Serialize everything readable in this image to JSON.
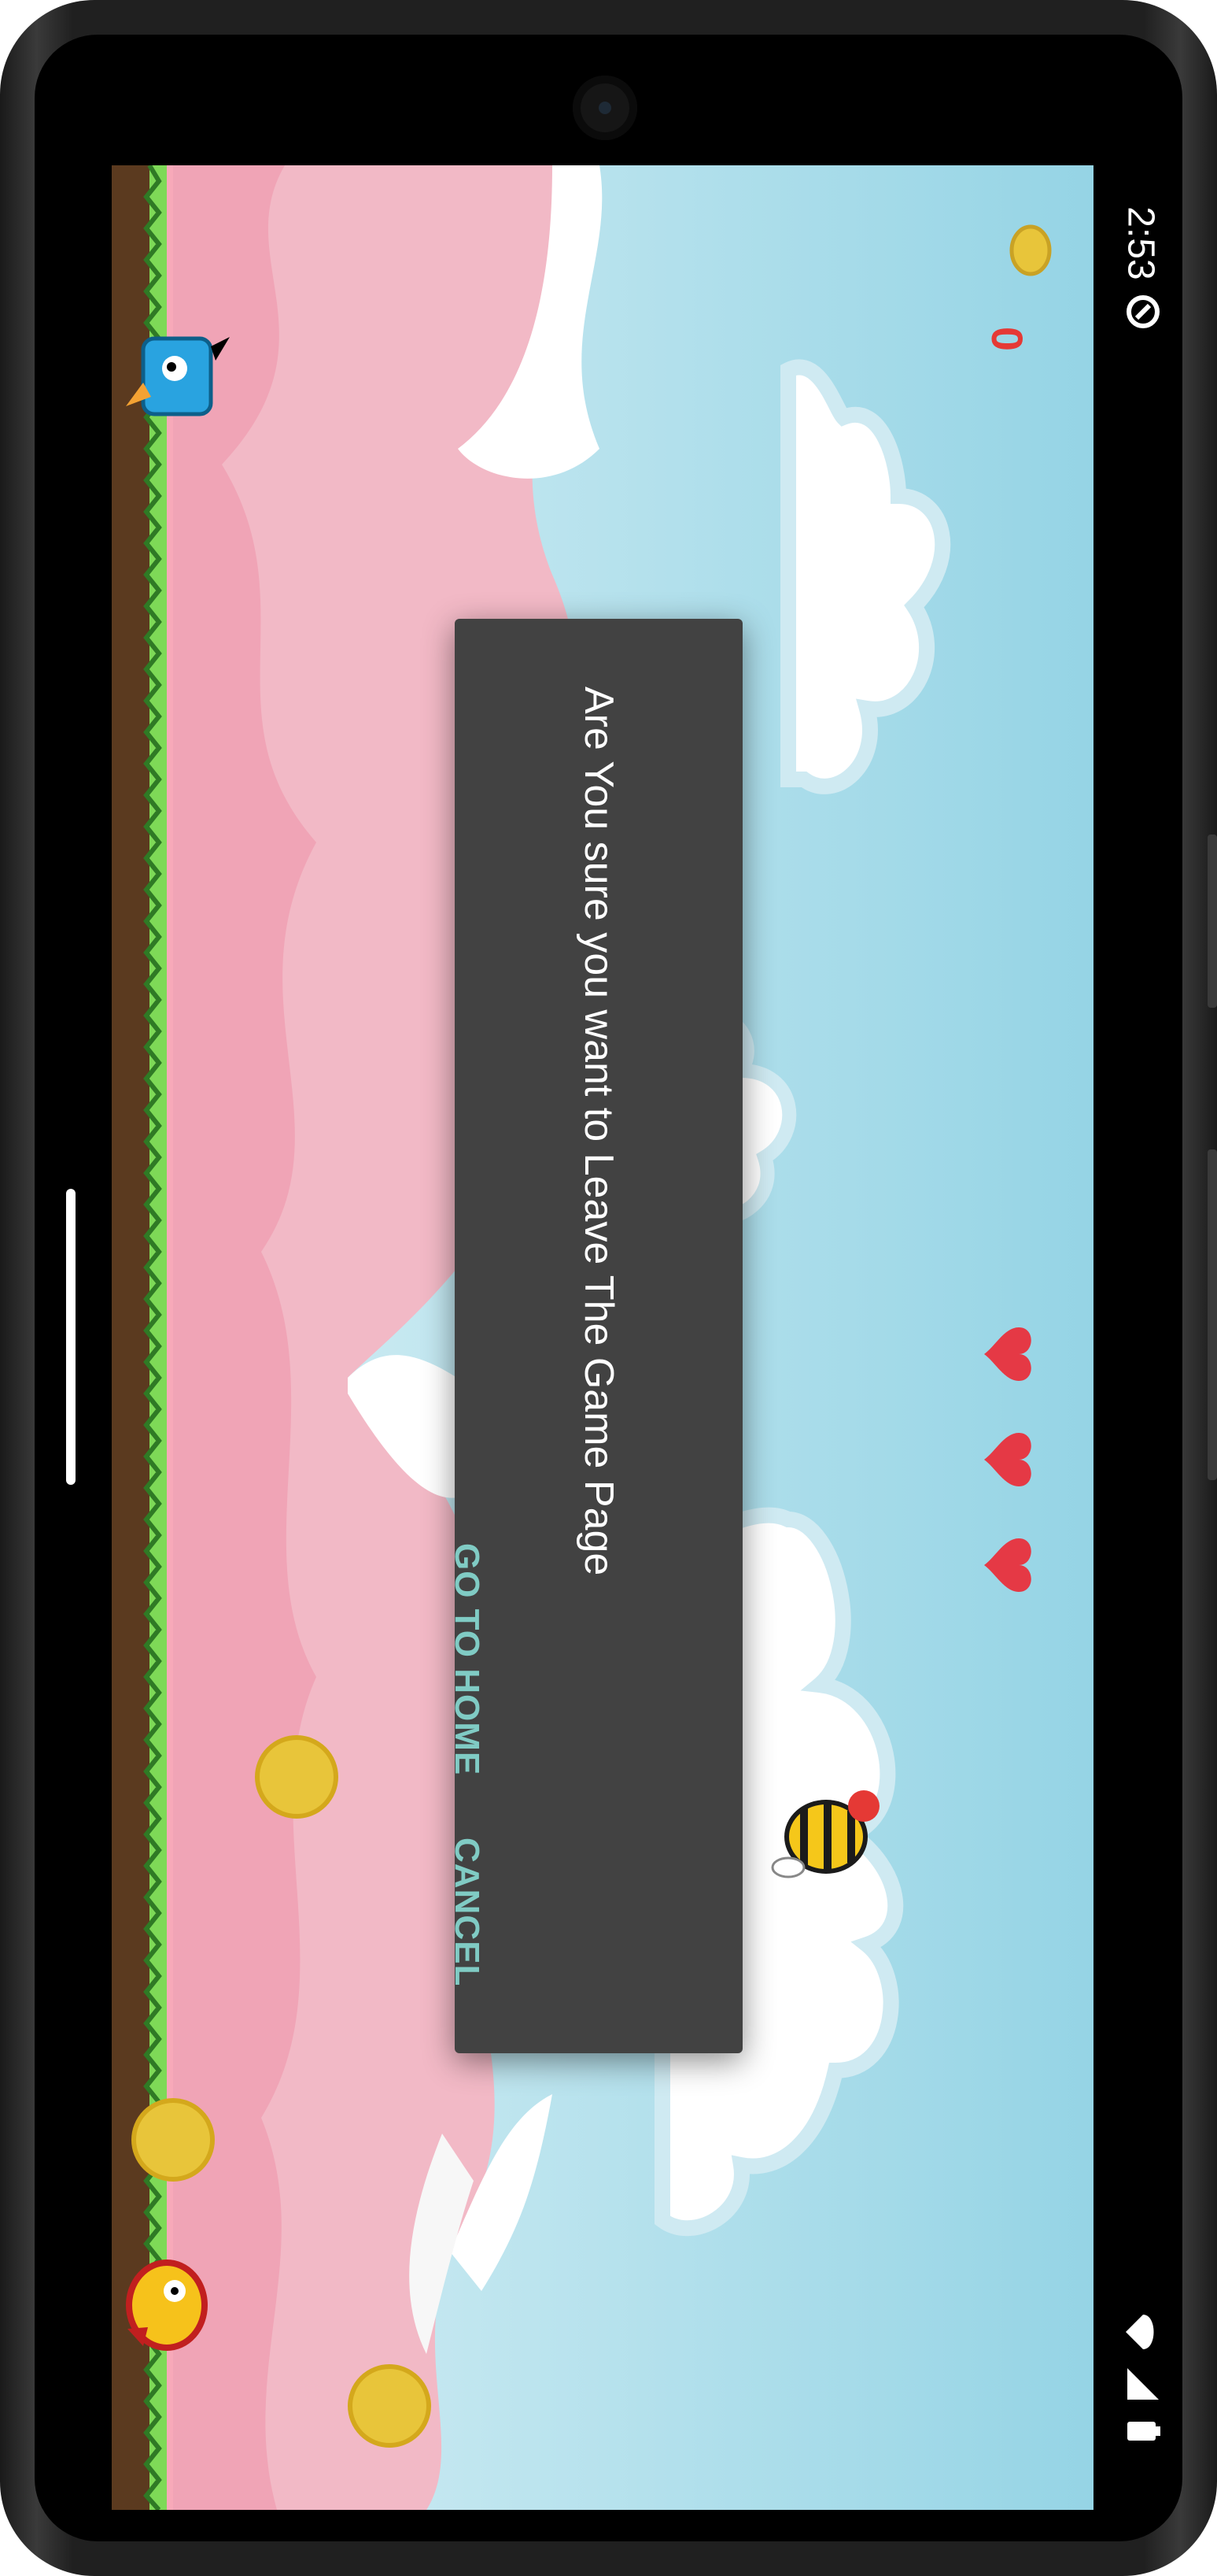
{
  "status_bar": {
    "time": "2:53"
  },
  "hud": {
    "coin_count": "0",
    "lives": 3
  },
  "dialog": {
    "message": "Are You sure you want to Leave The Game Page",
    "go_home_label": "GO TO HOME",
    "cancel_label": "CANCEL"
  },
  "colors": {
    "dialog_bg": "#424242",
    "dialog_button": "#80cbc4",
    "sky": "#9fd8e6",
    "mountain": "#f4b6c2",
    "grass": "#7ed957",
    "dirt": "#5b3a1f",
    "heart": "#e53945",
    "coin": "#e8c53a"
  },
  "icons": [
    "gear-icon",
    "wifi-icon",
    "signal-icon",
    "battery-icon",
    "coin-icon",
    "heart-icon"
  ]
}
